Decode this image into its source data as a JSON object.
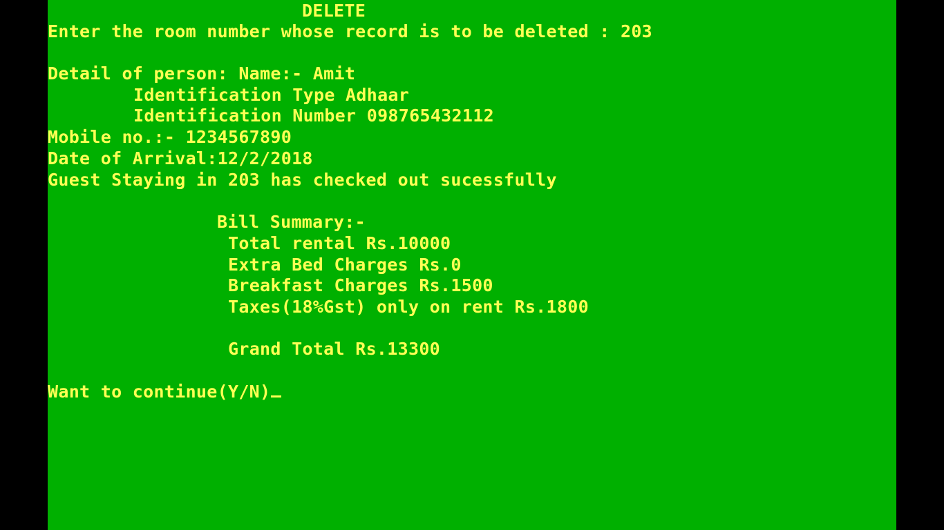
{
  "terminal": {
    "background_color": "#00b000",
    "text_color": "#ffff55",
    "heading": "DELETE",
    "prompt_room": "Enter the room number whose record is to be deleted : 203",
    "detail_name": "Detail of person: Name:- Amit",
    "id_type": "Identification Type Adhaar",
    "id_number": "Identification Number 098765432112",
    "mobile": "Mobile no.:- 1234567890",
    "arrival": "Date of Arrival:12/2/2018",
    "checkout_msg": "Guest Staying in 203 has checked out sucessfully",
    "bill_heading": "Bill Summary:-",
    "total_rental": "Total rental Rs.10000",
    "extra_bed": "Extra Bed Charges Rs.0",
    "breakfast": "Breakfast Charges Rs.1500",
    "taxes": "Taxes(18%Gst) only on rent Rs.1800",
    "grand_total": "Grand Total Rs.13300",
    "continue_prompt": "Want to continue(Y/N)"
  }
}
